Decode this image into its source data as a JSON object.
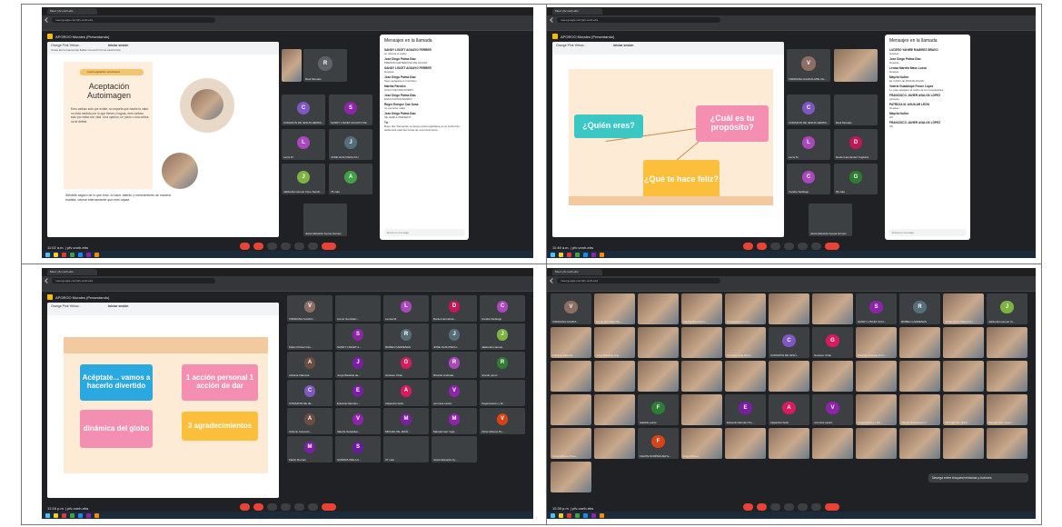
{
  "browser": {
    "tab_title": "Meet: pfv-vonh-ebs",
    "url": "meet.google.com/pfv-vonh-ebs"
  },
  "meet": {
    "presenter": "APOROO Morales (Presentando)",
    "code": "pfv-vonh-ebs"
  },
  "q1": {
    "time": "11:02 a.m.",
    "window_title": "Orange Pink Yellow...",
    "menu": "Todas las herramientas   Editar   Convertir   Firma electrónica",
    "start": "Iniciar sesión",
    "slide": {
      "badge": "Autorregulación emocional",
      "title": "Aceptación Autoimagen",
      "body1": "Eres valioso solo por existir, no importa que hacés tu valor no está medido por lo que tienes o logras, eres valioso solo por estar con vida. Una opinión, un juicio o una crítica no te define.",
      "body2": "Siéntete seguro de lo que eres, tu valor, talento y merecimiento de manera realista. valorar internamente que eres capaz"
    },
    "tiles": [
      {
        "name": "Raul Morales",
        "initial": "R",
        "color": "#5f6368"
      },
      {
        "name": "CORAZON DE JESUS HERRA...",
        "initial": "C",
        "color": "#7e57c2"
      },
      {
        "name": "SANDY LISCET AGUAYO FE...",
        "initial": "S",
        "color": "#8e24aa"
      },
      {
        "name": "Lenis M",
        "initial": "L",
        "color": "#ab47bc"
      },
      {
        "name": "JOSE JUAN PECH KU",
        "initial": "J",
        "color": "#546e7a"
      },
      {
        "name": "Jaktia Emmanuel Cime Sanch...",
        "initial": "J",
        "color": "#7cb342"
      },
      {
        "name": "75 más",
        "initial": "A",
        "color": "#43a047"
      },
      {
        "name": "Jesús Eduardo Ayuna Gómez",
        "initial": "",
        "color": "#5f6368"
      }
    ],
    "chat_title": "Mensajes en la llamada",
    "chat": [
      {
        "from": "SANDY LISCET AGUAYO FERRER",
        "text": "se oberva el audio"
      },
      {
        "from": "Jose Diego Palma Diaz",
        "text": "PRESION ARTERIOSA DE ALGUN"
      },
      {
        "from": "SANDY LISCET AGUAYO FERRER",
        "text": "Gracias"
      },
      {
        "from": "Jose Diego Palma Diaz",
        "text": "Sees apagará el micrófono"
      },
      {
        "from": "Martha Paredes",
        "text": "GOLO DE DISCOVERY"
      },
      {
        "from": "Jose Diego Palma Diaz",
        "text": "ESTA FUNCIONANDO"
      },
      {
        "from": "Roger Enrique Can Sosa",
        "text": "no escucho nada"
      },
      {
        "from": "Jose Diego Palma Diaz",
        "text": "SE HABLA PRESENT"
      },
      {
        "from": "Tú",
        "text": "Buen día. Recuerde su apoyo para registrarse en el control de asistencia para las horas de reconocimiento."
      }
    ],
    "chat_input": "Envía un mensaje"
  },
  "q2": {
    "time": "11:46 a.m.",
    "window_title": "Orange Pink Yellow...",
    "start": "Iniciar sesión",
    "stickers": [
      {
        "text": "¿Quién eres?",
        "bg": "#3bc7c4",
        "color": "#fff"
      },
      {
        "text": "¿Cuál es tu propósito?",
        "bg": "#f48fb1",
        "color": "#fff"
      },
      {
        "text": "¿Qué te hace feliz?",
        "bg": "#fbbf3b",
        "color": "#fff"
      }
    ],
    "tiles": [
      {
        "name": "VIRIDIANA GUADALUPE CH...",
        "initial": "V",
        "color": "#8d6e63"
      },
      {
        "name": "CORAZON DE JESUS HERRA...",
        "initial": "C",
        "color": "#7e57c2"
      },
      {
        "name": "Raul Morales",
        "initial": "",
        "color": "#5f6368"
      },
      {
        "name": "Lenis M",
        "initial": "L",
        "color": "#ab47bc"
      },
      {
        "name": "Daniel Hernandez Cuglotra",
        "initial": "D",
        "color": "#c2185b"
      },
      {
        "name": "Candie Santiago",
        "initial": "C",
        "color": "#ab47bc"
      },
      {
        "name": "66 más",
        "initial": "G",
        "color": "#2e7d32"
      },
      {
        "name": "Jesús Eduardo Ayuna Gómez",
        "initial": "",
        "color": "#5f6368"
      }
    ],
    "chat_title": "Mensajes en la llamada",
    "chat": [
      {
        "from": "LUCERO YAHIRE RAMIREZ BRAVO",
        "text": "Gracias"
      },
      {
        "from": "Jose Diego Palma Diaz",
        "text": "Gracias"
      },
      {
        "from": "Lenisa Mariela Mass Loeza",
        "text": "Gracias"
      },
      {
        "from": "Mayela Nuñez",
        "text": "EL CASO de PSICOLOGOS"
      },
      {
        "from": "Valeria Guadalupe Ponce López",
        "text": "Lo pare apagare el audio de la computadora"
      },
      {
        "from": "FRANCISCO JAVIER AVALOS LÓPEZ",
        "text": "perfecto"
      },
      {
        "from": "PATRICIA M. AGUILAR LEÓN",
        "text": "Gracias"
      },
      {
        "from": "Mayela Nuñez",
        "text": "OK"
      },
      {
        "from": "FRANCISCO JAVIER AVALOS LÓPEZ",
        "text": "OK"
      }
    ],
    "chat_input": "Envía un mensaje"
  },
  "q3": {
    "time": "12:16 p.m.",
    "window_title": "Orange Pink Yellow...",
    "start": "Iniciar sesión",
    "stickers": [
      {
        "text": "Acéptate... vamos a hacerlo divertido",
        "bg": "#29a9e0",
        "color": "#fff"
      },
      {
        "text": "1 acción personal 1 acción de dar",
        "bg": "#f48fb1",
        "color": "#fff"
      },
      {
        "text": "dinámica del globo",
        "bg": "#f48fb1",
        "color": "#fff"
      },
      {
        "text": "3 agradecimientos",
        "bg": "#fbbf3b",
        "color": "#fff"
      }
    ],
    "tiles": [
      {
        "name": "VIRIDIANA GUADA...",
        "initial": "V",
        "color": "#8d6e63"
      },
      {
        "name": "Llemo González...",
        "initial": "",
        "color": "#5f6368"
      },
      {
        "name": "Lenisa M.",
        "initial": "L",
        "color": "#ab47bc"
      },
      {
        "name": "Daniel Hernánde...",
        "initial": "D",
        "color": "#c2185b"
      },
      {
        "name": "Candie Santiago",
        "initial": "C",
        "color": "#ab47bc"
      },
      {
        "name": "Kalia Christel Osu...",
        "initial": "",
        "color": "#5f6368"
      },
      {
        "name": "SANDY LISCET A...",
        "initial": "S",
        "color": "#8e24aa"
      },
      {
        "name": "RUBEN CARDENAS",
        "initial": "R",
        "color": "#546e7a"
      },
      {
        "name": "JOSE JUAN PECH...",
        "initial": "J",
        "color": "#546e7a"
      },
      {
        "name": "Jaktia Emmanuel...",
        "initial": "J",
        "color": "#7cb342"
      },
      {
        "name": "Adriana Valencia",
        "initial": "A",
        "color": "#6d4c41"
      },
      {
        "name": "Jorge Bautista de...",
        "initial": "J",
        "color": "#7b1fa2"
      },
      {
        "name": "Gustavo Chan",
        "initial": "G",
        "color": "#d81b60"
      },
      {
        "name": "Ricardo Andrade",
        "initial": "R",
        "color": "#ab47bc"
      },
      {
        "name": "ricardo perez",
        "initial": "R",
        "color": "#2e7d32"
      },
      {
        "name": "CORAZON DE JE...",
        "initial": "C",
        "color": "#7e57c2"
      },
      {
        "name": "Eduardo Mendez...",
        "initial": "E",
        "color": "#7b1fa2"
      },
      {
        "name": "Alejandra Solis",
        "initial": "A",
        "color": "#d81b60"
      },
      {
        "name": "veronica castro",
        "initial": "V",
        "color": "#8e24aa"
      },
      {
        "name": "Organización y M...",
        "initial": "",
        "color": "#5f6368"
      },
      {
        "name": "Antonio Acevedo...",
        "initial": "A",
        "color": "#6d4c41"
      },
      {
        "name": "Valeria Guadalup...",
        "initial": "V",
        "color": "#8e24aa"
      },
      {
        "name": "MIGUEL DE JESÚ...",
        "initial": "M",
        "color": "#7b1fa2"
      },
      {
        "name": "Manuel Ivan Ygar...",
        "initial": "M",
        "color": "#8e24aa"
      },
      {
        "name": "Victor Alfonso Pe...",
        "initial": "V",
        "color": "#d84315"
      },
      {
        "name": "Martin Roman",
        "initial": "M",
        "color": "#7b1fa2"
      },
      {
        "name": "SANDRA ISELA A...",
        "initial": "S",
        "color": "#6a1b9a"
      },
      {
        "name": "47 más",
        "initial": "",
        "color": "#1565c0"
      },
      {
        "name": "Jesús Eduardo Ay...",
        "initial": "",
        "color": "#5f6368"
      }
    ]
  },
  "q4": {
    "time": "12:39 p.m.",
    "caption": "Navega entre bloques/ventanas y botones",
    "tiles": [
      {
        "name": "VIRIDIANA GUADA...",
        "initial": "V",
        "color": "#8d6e63",
        "photo": false
      },
      {
        "name": "Llemo González Be...",
        "initial": "",
        "color": "#5f6368",
        "photo": true
      },
      {
        "name": "",
        "initial": "",
        "color": "#5f6368",
        "photo": true
      },
      {
        "name": "Martha Díaz Hern...",
        "initial": "",
        "color": "#5f6368",
        "photo": true
      },
      {
        "name": "Organización Lero...",
        "initial": "",
        "color": "#5f6368",
        "photo": true
      },
      {
        "name": "",
        "initial": "",
        "color": "#5f6368",
        "photo": true
      },
      {
        "name": "",
        "initial": "",
        "color": "#5f6368",
        "photo": true
      },
      {
        "name": "SANDY LISCET AGU...",
        "initial": "S",
        "color": "#8e24aa",
        "photo": false
      },
      {
        "name": "RUBEN CARDENAS",
        "initial": "R",
        "color": "#546e7a",
        "photo": false
      },
      {
        "name": "JOSE JUAN PECH KU",
        "initial": "",
        "color": "#5f6368",
        "photo": true
      },
      {
        "name": "Jaktia Emmanuel Ci...",
        "initial": "J",
        "color": "#7cb342",
        "photo": false
      },
      {
        "name": "Adriana Valencia",
        "initial": "",
        "color": "#5f6368",
        "photo": true
      },
      {
        "name": "Jorge Bautista Ang...",
        "initial": "",
        "color": "#5f6368",
        "photo": true
      },
      {
        "name": "",
        "initial": "",
        "color": "#5f6368",
        "photo": true
      },
      {
        "name": "",
        "initial": "",
        "color": "#5f6368",
        "photo": true
      },
      {
        "name": "Carmen Flota Pérez",
        "initial": "",
        "color": "#5f6368",
        "photo": true
      },
      {
        "name": "CORAZÓN DE JESÚ...",
        "initial": "C",
        "color": "#7e57c2",
        "photo": false
      },
      {
        "name": "Gustavo Chan",
        "initial": "G",
        "color": "#d81b60",
        "photo": false
      },
      {
        "name": "Ricardo Andrade Prim...",
        "initial": "",
        "color": "#5f6368",
        "photo": true
      },
      {
        "name": "",
        "initial": "",
        "color": "#5f6368",
        "photo": true
      },
      {
        "name": "",
        "initial": "",
        "color": "#5f6368",
        "photo": true
      },
      {
        "name": "",
        "initial": "",
        "color": "#5f6368",
        "photo": true
      },
      {
        "name": "",
        "initial": "",
        "color": "#5f6368",
        "photo": true
      },
      {
        "name": "",
        "initial": "",
        "color": "#5f6368",
        "photo": true
      },
      {
        "name": "",
        "initial": "",
        "color": "#5f6368",
        "photo": true
      },
      {
        "name": "",
        "initial": "",
        "color": "#5f6368",
        "photo": true
      },
      {
        "name": "",
        "initial": "",
        "color": "#5f6368",
        "photo": true
      },
      {
        "name": "",
        "initial": "",
        "color": "#5f6368",
        "photo": true
      },
      {
        "name": "",
        "initial": "",
        "color": "#5f6368",
        "photo": true
      },
      {
        "name": "",
        "initial": "",
        "color": "#5f6368",
        "photo": true
      },
      {
        "name": "",
        "initial": "",
        "color": "#5f6368",
        "photo": true
      },
      {
        "name": "",
        "initial": "",
        "color": "#5f6368",
        "photo": true
      },
      {
        "name": "",
        "initial": "",
        "color": "#5f6368",
        "photo": true
      },
      {
        "name": "",
        "initial": "",
        "color": "#5f6368",
        "photo": true
      },
      {
        "name": "",
        "initial": "",
        "color": "#5f6368",
        "photo": true
      },
      {
        "name": "Isabelle peres",
        "initial": "F",
        "color": "#2e7d32",
        "photo": false
      },
      {
        "name": "",
        "initial": "",
        "color": "#5f6368",
        "photo": true
      },
      {
        "name": "Eduardo Mendez Ro...",
        "initial": "E",
        "color": "#7b1fa2",
        "photo": false
      },
      {
        "name": "Alejandra Solis",
        "initial": "A",
        "color": "#d81b60",
        "photo": false
      },
      {
        "name": "veronica castro",
        "initial": "V",
        "color": "#8e24aa",
        "photo": false
      },
      {
        "name": "Organización y Mé...",
        "initial": "",
        "color": "#5f6368",
        "photo": true
      },
      {
        "name": "Valeria Guadalupe P...",
        "initial": "",
        "color": "#5f6368",
        "photo": true
      },
      {
        "name": "MIGUEL DE JESÚ...",
        "initial": "",
        "color": "#5f6368",
        "photo": true
      },
      {
        "name": "Manuel Ivan Yépez ...",
        "initial": "",
        "color": "#5f6368",
        "photo": true
      },
      {
        "name": "Victor Alfonso Pére...",
        "initial": "",
        "color": "#5f6368",
        "photo": true
      },
      {
        "name": "",
        "initial": "",
        "color": "#5f6368",
        "photo": true
      },
      {
        "name": "FELIPE DOMÍNGUEZ E...",
        "initial": "F",
        "color": "#d84315",
        "photo": false
      },
      {
        "name": "Angel Flores",
        "initial": "",
        "color": "#5f6368",
        "photo": true
      },
      {
        "name": "",
        "initial": "",
        "color": "#5f6368",
        "photo": true
      },
      {
        "name": "",
        "initial": "",
        "color": "#5f6368",
        "photo": true
      },
      {
        "name": "",
        "initial": "",
        "color": "#5f6368",
        "photo": true
      },
      {
        "name": "",
        "initial": "",
        "color": "#5f6368",
        "photo": true
      },
      {
        "name": "",
        "initial": "",
        "color": "#5f6368",
        "photo": true
      },
      {
        "name": "",
        "initial": "",
        "color": "#5f6368",
        "photo": true
      },
      {
        "name": "",
        "initial": "",
        "color": "#5f6368",
        "photo": true
      },
      {
        "name": "",
        "initial": "",
        "color": "#5f6368",
        "photo": true
      }
    ]
  },
  "accent": {
    "meet_bg": "#202124",
    "end_call": "#ea4335",
    "chat_link": "#1a73e8"
  }
}
